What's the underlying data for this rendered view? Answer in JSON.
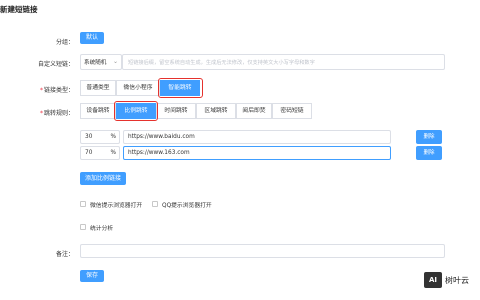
{
  "page_title": "新建短链接",
  "group": {
    "label": "分组：",
    "button": "默认"
  },
  "custom": {
    "label": "自定义短链：",
    "select_value": "系统随机",
    "placeholder": "短链接后缀，留空系统自动生成，生成后无法修改，仅支持英文大小写字母和数字"
  },
  "link_type": {
    "label": "链接类型：",
    "options": [
      "普通类型",
      "微信小程序",
      "智能跳转"
    ],
    "active": "智能跳转"
  },
  "jump_rule": {
    "label": "跳转规则：",
    "options": [
      "设备跳转",
      "比例跳转",
      "时间跳转",
      "区域跳转",
      "阅后即焚",
      "密码短链"
    ],
    "active": "比例跳转"
  },
  "ratio_rows": [
    {
      "percent": "30",
      "unit": "%",
      "url": "https://www.baidu.com",
      "delete": "删除"
    },
    {
      "percent": "70",
      "unit": "%",
      "url": "https://www.163.com",
      "delete": "删除"
    }
  ],
  "add_rule_button": "添加比例链接",
  "options": {
    "wechat_browser": "微信提示浏览器打开",
    "qq_browser": "QQ提示浏览器打开",
    "statistics": "统计分析"
  },
  "remark": {
    "label": "备注：",
    "value": ""
  },
  "save_button": "保存",
  "watermark": {
    "logo": "AI",
    "text": "树叶云"
  },
  "colors": {
    "primary": "#409eff",
    "highlight": "#e5322d"
  }
}
